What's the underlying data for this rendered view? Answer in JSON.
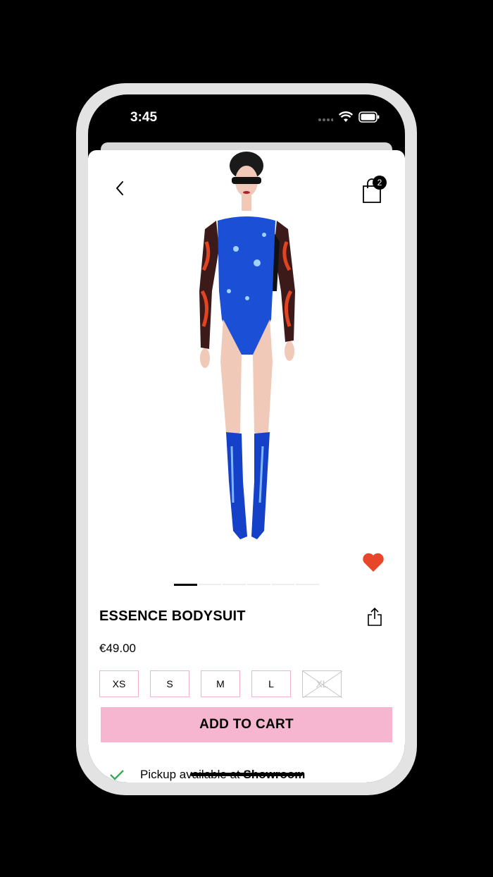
{
  "status_bar": {
    "time": "3:45"
  },
  "header": {
    "cart_count": "2"
  },
  "product": {
    "title": "ESSENCE BODYSUIT",
    "price": "€49.00",
    "sizes": [
      {
        "label": "XS",
        "available": true
      },
      {
        "label": "S",
        "available": true
      },
      {
        "label": "M",
        "available": true
      },
      {
        "label": "L",
        "available": true
      },
      {
        "label": "XL",
        "available": false
      }
    ],
    "add_to_cart_label": "ADD TO CART",
    "favorite": true
  },
  "carousel": {
    "count": 6,
    "active_index": 0
  },
  "pickup": {
    "prefix": "Pickup available at",
    "location": "Showroom"
  },
  "colors": {
    "accent_pink": "#f7b6cf",
    "size_border": "#f4b4c8",
    "heart": "#e8462a",
    "check": "#3aaa5c",
    "bodysuit_blue": "#1b4fd6"
  }
}
